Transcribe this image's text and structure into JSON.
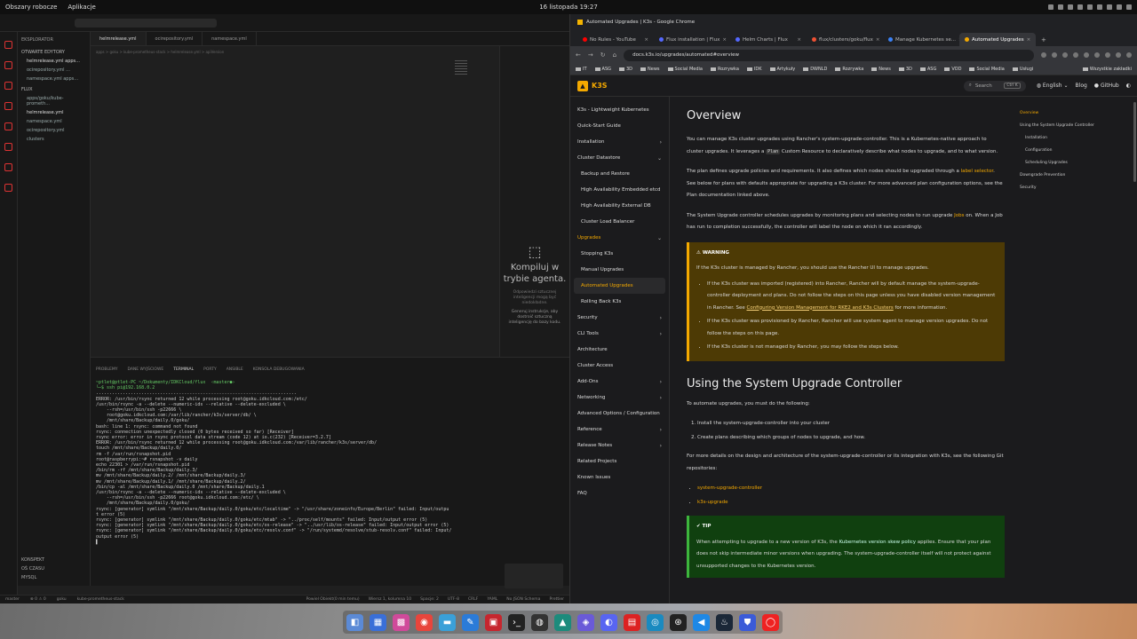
{
  "system": {
    "workspaces": "Obszary robocze",
    "apps": "Aplikacje",
    "clock": "16 listopada 19:27"
  },
  "vscode": {
    "explorer_title": "EKSPLORATOR",
    "open_editors": "OTWARTE EDYTORY",
    "open_files": [
      "helmrelease.yml apps...",
      "ocirepository.yml ...",
      "namespace.yml apps..."
    ],
    "root": "FLUX",
    "folder": "apps/goku/kube-prometh...",
    "files": [
      "helmrelease.yml",
      "namespace.yml",
      "ocirepository.yml",
      "clusters"
    ],
    "bottom_sections": [
      "KONSPEKT",
      "OŚ CZASU",
      "MYSQL"
    ],
    "tabs": [
      "helmrelease.yml",
      "ocirepository.yml",
      "namespace.yml"
    ],
    "breadcrumb": "apps > goku > kube-prometheus-stack > helmrelease.yml > apiVersion",
    "agent": {
      "title": "Kompiluj w trybie agenta.",
      "note1": "Odpowiedzi sztucznej inteligencji mogą być niedokładne.",
      "note2": "Generuj instrukcje, aby dostroić sztuczną inteligencję do bazy kodu."
    },
    "panel_tabs": [
      "PROBLEMY",
      "DANE WYJŚCIOWE",
      "TERMINAL",
      "PORTY",
      "ANSIBLE",
      "KONSOLA DEBUGOWANIA"
    ],
    "terminal_lines": [
      "~ptlet@ptlet-PC ~/Dokumenty/IDKCloud/flux  ‹master●›",
      "└─$ ssh pi@192.168.0.2",
      "...........................................................................",
      "ERROR: /usr/bin/rsync returned 12 while processing root@goku.idkcloud.com:/etc/",
      "/usr/bin/rsync -a --delete --numeric-ids --relative --delete-excluded \\",
      "    --rsh=/usr/bin/ssh -p22666 \\",
      "    root@goku.idkcloud.com:/var/lib/rancher/k3s/server/db/ \\",
      "    /mnt/share/Backup/daily.0/goku/",
      "bash: line 1: rsync: command not found",
      "rsync: connection unexpectedly closed (0 bytes received so far) [Receiver]",
      "rsync error: error in rsync protocol data stream (code 12) at io.c(232) [Receiver=3.2.7]",
      "ERROR: /usr/bin/rsync returned 12 while processing root@goku.idkcloud.com:/var/lib/rancher/k3s/server/db/",
      "touch /mnt/share/Backup/daily.0/",
      "rm -f /var/run/rsnapshot.pid",
      "root@raspberrypi:~# rsnapshot -v daily",
      "echo 22301 > /var/run/rsnapshot.pid",
      "/bin/rm -rf /mnt/share/Backup/daily.3/",
      "mv /mnt/share/Backup/daily.2/ /mnt/share/Backup/daily.3/",
      "mv /mnt/share/Backup/daily.1/ /mnt/share/Backup/daily.2/",
      "/bin/cp -al /mnt/share/Backup/daily.0 /mnt/share/Backup/daily.1",
      "/usr/bin/rsync -a --delete --numeric-ids --relative --delete-excluded \\",
      "    --rsh=/usr/bin/ssh -p22666 root@goku.idkcloud.com:/etc/ \\",
      "    /mnt/share/Backup/daily.0/goku/",
      "rsync: [generator] symlink \"/mnt/share/Backup/daily.0/goku/etc/localtime\" -> \"/usr/share/zoneinfo/Europe/Berlin\" failed: Input/outpu",
      "t error (5)",
      "rsync: [generator] symlink \"/mnt/share/Backup/daily.0/goku/etc/mtab\" -> \"../proc/self/mounts\" failed: Input/output error (5)",
      "rsync: [generator] symlink \"/mnt/share/Backup/daily.0/goku/etc/os-release\" -> \"../usr/lib/os-release\" failed: Input/output error (5)",
      "rsync: [generator] symlink \"/mnt/share/Backup/daily.0/goku/etc/resolv.conf\" -> \"/run/systemd/resolve/stub-resolv.conf\" failed: Input/",
      "output error (5)",
      "▌"
    ],
    "status_left": [
      "master",
      "⊗ 0 ⚠ 0",
      "goku",
      "kube-prometheus-stack"
    ],
    "status_right": [
      "Powiel Obiekt(0 min temu)",
      "Wiersz 1, kolumna 10",
      "Spacje: 2",
      "UTF-8",
      "CRLF",
      "YAML",
      "No JSON Schema",
      "Prettier"
    ]
  },
  "chrome": {
    "window_title": "Automated Upgrades | K3s - Google Chrome",
    "tabs": [
      {
        "label": "No Rules - YouTube",
        "color": "#ff0000",
        "active": false
      },
      {
        "label": "Flux installation | Flux",
        "color": "#5468ff",
        "active": false
      },
      {
        "label": "Helm Charts | Flux",
        "color": "#5468ff",
        "active": false
      },
      {
        "label": "flux/clusters/goku/flux",
        "color": "#f05133",
        "active": false
      },
      {
        "label": "Manage Kubernetes se...",
        "color": "#3b82f6",
        "active": false
      },
      {
        "label": "Automated Upgrades",
        "color": "#f4a900",
        "active": true
      }
    ],
    "url": "docs.k3s.io/upgrades/automated#overview",
    "bookmarks": [
      "IT",
      "ASG",
      "3D",
      "News",
      "Social Media",
      "Rozrywka",
      "IDK",
      "Artykuły",
      "DWNLD",
      "Rozrywka",
      "News",
      "3D",
      "ASG",
      "VOD",
      "Social Media",
      "Usługi"
    ],
    "all_bookmarks": "Wszystkie zakładki"
  },
  "site": {
    "logo": "K3S",
    "search": "Search",
    "shortcut": "Ctrl K",
    "language": "English",
    "blog": "Blog",
    "github": "GitHub",
    "nav": [
      {
        "label": "K3s - Lightweight Kubernetes",
        "type": "item",
        "chev": ""
      },
      {
        "label": "Quick-Start Guide",
        "type": "item",
        "chev": ""
      },
      {
        "label": "Installation",
        "type": "item",
        "chev": "›"
      },
      {
        "label": "Cluster Datastore",
        "type": "item",
        "chev": "⌄"
      },
      {
        "label": "Backup and Restore",
        "type": "sub",
        "chev": ""
      },
      {
        "label": "High Availability Embedded etcd",
        "type": "sub",
        "chev": ""
      },
      {
        "label": "High Availability External DB",
        "type": "sub",
        "chev": ""
      },
      {
        "label": "Cluster Load Balancer",
        "type": "sub",
        "chev": ""
      },
      {
        "label": "Upgrades",
        "type": "cat",
        "chev": "⌄"
      },
      {
        "label": "Stopping K3s",
        "type": "sub",
        "chev": ""
      },
      {
        "label": "Manual Upgrades",
        "type": "sub",
        "chev": ""
      },
      {
        "label": "Automated Upgrades",
        "type": "active",
        "chev": ""
      },
      {
        "label": "Rolling Back K3s",
        "type": "sub",
        "chev": ""
      },
      {
        "label": "Security",
        "type": "item",
        "chev": "›"
      },
      {
        "label": "CLI Tools",
        "type": "item",
        "chev": "›"
      },
      {
        "label": "Architecture",
        "type": "item",
        "chev": ""
      },
      {
        "label": "Cluster Access",
        "type": "item",
        "chev": ""
      },
      {
        "label": "Add-Ons",
        "type": "item",
        "chev": "›"
      },
      {
        "label": "Networking",
        "type": "item",
        "chev": "›"
      },
      {
        "label": "Advanced Options / Configuration",
        "type": "item",
        "chev": ""
      },
      {
        "label": "Reference",
        "type": "item",
        "chev": "›"
      },
      {
        "label": "Release Notes",
        "type": "item",
        "chev": "›"
      },
      {
        "label": "Related Projects",
        "type": "item",
        "chev": ""
      },
      {
        "label": "Known Issues",
        "type": "item",
        "chev": ""
      },
      {
        "label": "FAQ",
        "type": "item",
        "chev": ""
      }
    ],
    "h1": "Overview",
    "p1a": "You can manage K3s cluster upgrades using Rancher's system-upgrade-controller. This is a Kubernetes-native approach to cluster upgrades. It leverages a ",
    "p1code": "Plan",
    "p1b": " Custom Resource to declaratively describe what nodes to upgrade, and to what version.",
    "p2a": "The plan defines upgrade policies and requirements. It also defines which nodes should be upgraded through a ",
    "p2link": "label selector",
    "p2b": ". See below for plans with defaults appropriate for upgrading a K3s cluster. For more advanced plan configuration options, see the Plan documentation linked above.",
    "p3a": "The System Upgrade controller schedules upgrades by monitoring plans and selecting nodes to run upgrade ",
    "p3link": "Jobs",
    "p3b": " on. When a Job has run to completion successfully, the controller will label the node on which it ran accordingly.",
    "warning_title": "WARNING",
    "warning_intro": "If the K3s cluster is managed by Rancher, you should use the Rancher UI to manage upgrades.",
    "warning_items": [
      "If the K3s cluster was imported (registered) into Rancher, Rancher will by default manage the system-upgrade-controller deployment and plans. Do not follow the steps on this page unless you have disabled version management in Rancher.",
      "If the K3s cluster was provisioned by Rancher, Rancher will use system agent to manage version upgrades. Do not follow the steps on this page.",
      "If the K3s cluster is not managed by Rancher, you may follow the steps below."
    ],
    "warning_see": "See ",
    "warning_link": "Configuring Version Management for RKE2 and K3s Clusters",
    "warning_more": " for more information.",
    "h2": "Using the System Upgrade Controller",
    "p4": "To automate upgrades, you must do the following:",
    "steps": [
      "Install the system-upgrade-controller into your cluster",
      "Create plans describing which groups of nodes to upgrade, and how."
    ],
    "p5": "For more details on the design and architecture of the system-upgrade-controller or its integration with K3s, see the following Git repositories:",
    "repos": [
      "system-upgrade-controller",
      "k3s-upgrade"
    ],
    "tip_title": "TIP",
    "tip_a": "When attempting to upgrade to a new version of K3s, the ",
    "tip_link": "Kubernetes version skew policy",
    "tip_b": " applies. Ensure that your plan does not skip intermediate minor versions when upgrading. The system-upgrade-controller itself will not protect against unsupported changes to the Kubernetes version.",
    "toc": [
      {
        "label": "Overview",
        "level": 0
      },
      {
        "label": "Using the System Upgrade Controller",
        "level": 0
      },
      {
        "label": "Installation",
        "level": 1
      },
      {
        "label": "Configuration",
        "level": 1
      },
      {
        "label": "Scheduling Upgrades",
        "level": 1
      },
      {
        "label": "Downgrade Prevention",
        "level": 0
      },
      {
        "label": "Security",
        "level": 0
      }
    ]
  },
  "taskbar": {
    "apps": [
      {
        "name": "files-icon",
        "color": "#5b8ad6",
        "glyph": "◧"
      },
      {
        "name": "manager-icon",
        "color": "#3a6fd8",
        "glyph": "▦"
      },
      {
        "name": "grid-icon",
        "color": "#d04a9a",
        "glyph": "▩"
      },
      {
        "name": "chrome-icon",
        "color": "#e8453c",
        "glyph": "◉"
      },
      {
        "name": "folder-icon",
        "color": "#3aa0d8",
        "glyph": "▬"
      },
      {
        "name": "editor-icon",
        "color": "#2b7bd8",
        "glyph": "✎"
      },
      {
        "name": "app-red-icon",
        "color": "#c6262e",
        "glyph": "▣"
      },
      {
        "name": "terminal-icon",
        "color": "#222",
        "glyph": "›_"
      },
      {
        "name": "github-icon",
        "color": "#333",
        "glyph": "◍"
      },
      {
        "name": "cat-icon",
        "color": "#1c8b7c",
        "glyph": "▲"
      },
      {
        "name": "drive-icon",
        "color": "#6a5ad8",
        "glyph": "◈"
      },
      {
        "name": "discord-icon",
        "color": "#5865f2",
        "glyph": "◐"
      },
      {
        "name": "pdf-icon",
        "color": "#d22",
        "glyph": "▤"
      },
      {
        "name": "app-teal-icon",
        "color": "#1a8ac0",
        "glyph": "◎"
      },
      {
        "name": "steam-circle-icon",
        "color": "#222",
        "glyph": "⊛"
      },
      {
        "name": "vscode-icon",
        "color": "#1e88e5",
        "glyph": "◀"
      },
      {
        "name": "steam-icon",
        "color": "#1b2838",
        "glyph": "♨"
      },
      {
        "name": "shield-icon",
        "color": "#3b5bd8",
        "glyph": "⛊"
      },
      {
        "name": "opera-icon",
        "color": "#e22",
        "glyph": "◯"
      }
    ]
  }
}
